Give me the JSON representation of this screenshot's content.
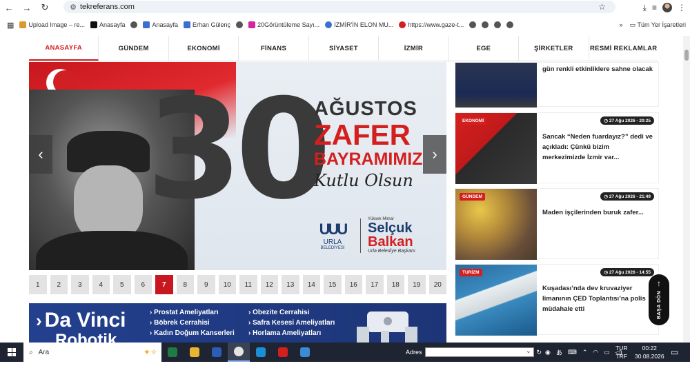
{
  "browser": {
    "url": "tekreferans.com",
    "bookmarks": [
      {
        "label": "Upload Image – re...",
        "color": "#d99a2b"
      },
      {
        "label": "Anasayfa",
        "color": "#111111"
      },
      {
        "label": "",
        "color": "#555555"
      },
      {
        "label": "Anasayfa",
        "color": "#3b6fd1"
      },
      {
        "label": "Erhan Gülenç",
        "color": "#3b6fd1"
      },
      {
        "label": "",
        "color": "#555555"
      },
      {
        "label": "20Görüntüleme Sayı...",
        "color": "#d6249f"
      },
      {
        "label": "İZMİR'İN ELON MU...",
        "color": "#3b6fd1"
      },
      {
        "label": "https://www.gaze-t...",
        "color": "#d41f1f"
      }
    ],
    "more_label": "»",
    "all_bookmarks_label": "Tüm Yer İşaretleri"
  },
  "nav": {
    "items": [
      "ANASAYFA",
      "GÜNDEM",
      "EKONOMİ",
      "FİNANS",
      "SİYASET",
      "İZMİR",
      "EGE",
      "ŞİRKETLER",
      "RESMİ REKLAMLAR"
    ],
    "active_index": 0
  },
  "slider": {
    "number": "30",
    "line1": "AĞUSTOS",
    "line2": "ZAFER",
    "line3": "BAYRAMIMIZ",
    "line4": "Kutlu Olsun",
    "urla_mark": "UUU",
    "urla_name": "URLA",
    "urla_sub": "BELEDİYESİ",
    "mayor_small": "Yüksek Mimar",
    "mayor_first": "Selçuk",
    "mayor_last": "Balkan",
    "mayor_role": "Urla Belediye Başkanı",
    "prev_icon": "‹",
    "next_icon": "›"
  },
  "pagination": {
    "pages": [
      "1",
      "2",
      "3",
      "4",
      "5",
      "6",
      "7",
      "8",
      "9",
      "10",
      "11",
      "12",
      "13",
      "14",
      "15",
      "16",
      "17",
      "18",
      "19",
      "20"
    ],
    "active": "7"
  },
  "banner": {
    "brand_line1": "Da Vinci",
    "brand_line2": "Robotik",
    "col1": [
      "Prostat Ameliyatları",
      "Böbrek Cerrahisi",
      "Kadın Doğum Kanserleri"
    ],
    "col2": [
      "Obezite Cerrahisi",
      "Safra Kesesi Ameliyatları",
      "Horlama Ameliyatları"
    ]
  },
  "news": [
    {
      "category": "",
      "date": "",
      "title": "gün renkli etkinliklere sahne olacak"
    },
    {
      "category": "EKONOMİ",
      "date": "27 Ağu 2026 - 20:25",
      "title": "Sancak “Neden fuardayız?” dedi ve açıkladı: Çünkü bizim merkezimizde İzmir var..."
    },
    {
      "category": "GÜNDEM",
      "date": "27 Ağu 2026 - 21:49",
      "title": "Maden işçilerinden buruk zafer..."
    },
    {
      "category": "TURİZM",
      "date": "27 Ağu 2026 - 14:55",
      "title": "Kuşadası’nda dev kruvaziyer limanının ÇED Toplantısı’na polis müdahale etti"
    }
  ],
  "back_to_top": {
    "label": "BAŞA DÖN",
    "icon": "↑"
  },
  "taskbar": {
    "search_placeholder": "Ara",
    "address_label": "Adres",
    "lang1": "TUR",
    "lang2": "TRF",
    "time": "00:22",
    "date": "30.08.2026",
    "apps": [
      {
        "name": "excel-icon",
        "color": "#1f7a45"
      },
      {
        "name": "file-explorer-icon",
        "color": "#e8b52f"
      },
      {
        "name": "word-icon",
        "color": "#2b5cb8"
      },
      {
        "name": "chrome-icon",
        "color": "#e4e4e4"
      },
      {
        "name": "edge-icon",
        "color": "#1b8fd6"
      },
      {
        "name": "opera-icon",
        "color": "#d41f1f"
      },
      {
        "name": "app-icon",
        "color": "#3a8ad6"
      }
    ]
  }
}
